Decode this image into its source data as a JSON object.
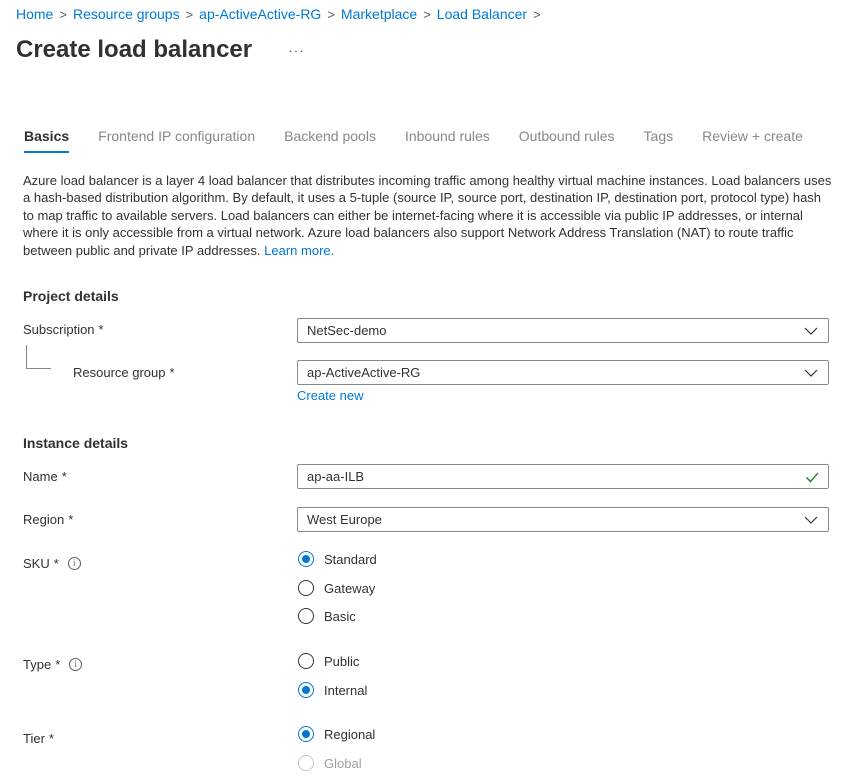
{
  "breadcrumb": {
    "items": [
      "Home",
      "Resource groups",
      "ap-ActiveActive-RG",
      "Marketplace",
      "Load Balancer"
    ],
    "separator": ">"
  },
  "page": {
    "title": "Create load balancer",
    "more": "···"
  },
  "tabs": [
    "Basics",
    "Frontend IP configuration",
    "Backend pools",
    "Inbound rules",
    "Outbound rules",
    "Tags",
    "Review + create"
  ],
  "active_tab": "Basics",
  "description": {
    "text": "Azure load balancer is a layer 4 load balancer that distributes incoming traffic among healthy virtual machine instances. Load balancers uses a hash-based distribution algorithm. By default, it uses a 5-tuple (source IP, source port, destination IP, destination port, protocol type) hash to map traffic to available servers. Load balancers can either be internet-facing where it is accessible via public IP addresses, or internal where it is only accessible from a virtual network. Azure load balancers also support Network Address Translation (NAT) to route traffic between public and private IP addresses.",
    "link": "Learn more."
  },
  "project_details": {
    "heading": "Project details",
    "subscription": {
      "label": "Subscription",
      "value": "NetSec-demo"
    },
    "resource_group": {
      "label": "Resource group",
      "value": "ap-ActiveActive-RG",
      "create_new": "Create new"
    }
  },
  "instance_details": {
    "heading": "Instance details",
    "name": {
      "label": "Name",
      "value": "ap-aa-ILB"
    },
    "region": {
      "label": "Region",
      "value": "West Europe"
    },
    "sku": {
      "label": "SKU",
      "options": [
        "Standard",
        "Gateway",
        "Basic"
      ],
      "selected": "Standard"
    },
    "type": {
      "label": "Type",
      "options": [
        "Public",
        "Internal"
      ],
      "selected": "Internal"
    },
    "tier": {
      "label": "Tier",
      "options": [
        "Regional",
        "Global"
      ],
      "selected": "Regional",
      "disabled": [
        "Global"
      ]
    }
  },
  "required_marker": "*",
  "info_glyph": "i",
  "colors": {
    "accent": "#0078d4",
    "success": "#107c10",
    "text": "#323130",
    "muted": "#8a8886"
  }
}
